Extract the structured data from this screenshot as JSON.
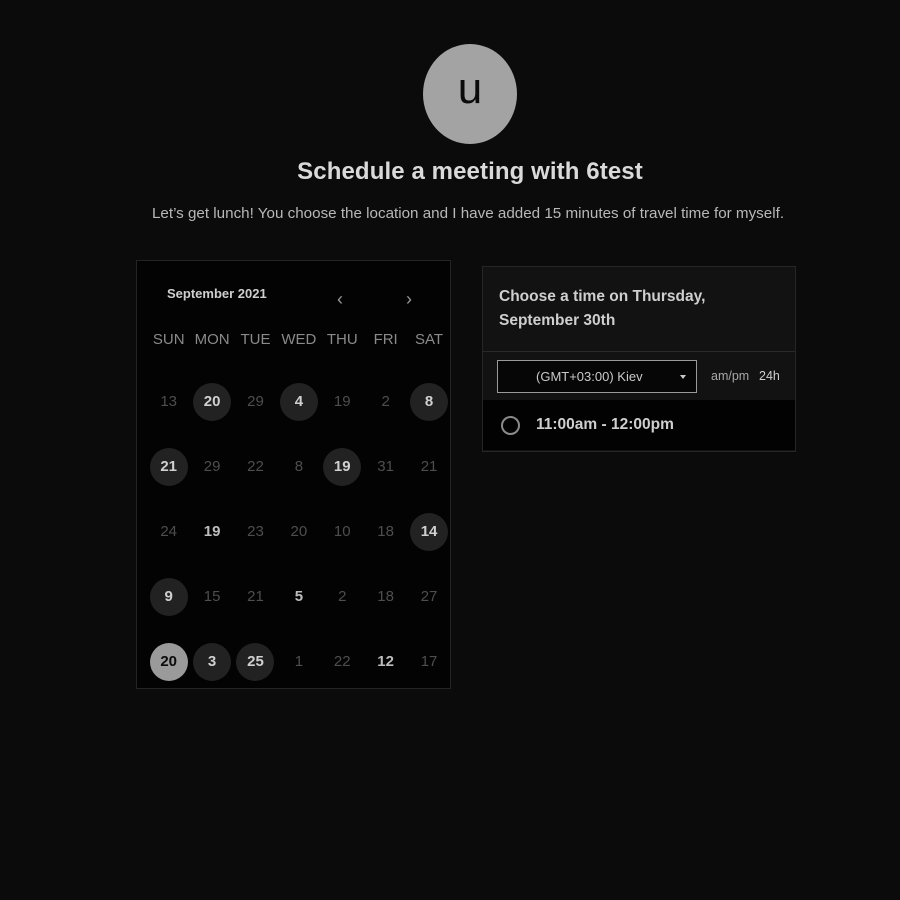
{
  "host": {
    "avatar_initial": "u",
    "title": "Schedule a meeting with 6test",
    "description": "Let’s get lunch! You choose the location and I have added 15 minutes of travel time for myself."
  },
  "calendar": {
    "month_label": "September 2021",
    "prev_icon": "chevron-left-icon",
    "next_icon": "chevron-right-icon",
    "weekdays": [
      "SUN",
      "MON",
      "TUE",
      "WED",
      "THU",
      "FRI",
      "SAT"
    ],
    "weeks": [
      [
        {
          "d": "13",
          "s": "dim"
        },
        {
          "d": "20",
          "s": "avail"
        },
        {
          "d": "29",
          "s": "dim"
        },
        {
          "d": "4",
          "s": "avail"
        },
        {
          "d": "19",
          "s": "dim"
        },
        {
          "d": "2",
          "s": "dim"
        },
        {
          "d": "8",
          "s": "avail"
        }
      ],
      [
        {
          "d": "21",
          "s": "avail"
        },
        {
          "d": "29",
          "s": "dim"
        },
        {
          "d": "22",
          "s": "dim"
        },
        {
          "d": "8",
          "s": "dim"
        },
        {
          "d": "19",
          "s": "avail"
        },
        {
          "d": "31",
          "s": "dim"
        },
        {
          "d": "21",
          "s": "dim"
        }
      ],
      [
        {
          "d": "24",
          "s": "dim"
        },
        {
          "d": "19",
          "s": "plain"
        },
        {
          "d": "23",
          "s": "dim"
        },
        {
          "d": "20",
          "s": "dim"
        },
        {
          "d": "10",
          "s": "dim"
        },
        {
          "d": "18",
          "s": "dim"
        },
        {
          "d": "14",
          "s": "avail"
        }
      ],
      [
        {
          "d": "9",
          "s": "avail"
        },
        {
          "d": "15",
          "s": "dim"
        },
        {
          "d": "21",
          "s": "dim"
        },
        {
          "d": "5",
          "s": "plain"
        },
        {
          "d": "2",
          "s": "dim"
        },
        {
          "d": "18",
          "s": "dim"
        },
        {
          "d": "27",
          "s": "dim"
        }
      ],
      [
        {
          "d": "20",
          "s": "sel"
        },
        {
          "d": "3",
          "s": "avail"
        },
        {
          "d": "25",
          "s": "avail"
        },
        {
          "d": "1",
          "s": "dim"
        },
        {
          "d": "22",
          "s": "dim"
        },
        {
          "d": "12",
          "s": "plain"
        },
        {
          "d": "17",
          "s": "dim"
        }
      ]
    ]
  },
  "time_panel": {
    "heading": "Choose a time on Thursday, September 30th",
    "timezone": "(GMT+03:00) Kiev",
    "format_ampm": "am/pm",
    "format_24h": "24h",
    "slots": [
      "11:00am - 12:00pm"
    ]
  }
}
